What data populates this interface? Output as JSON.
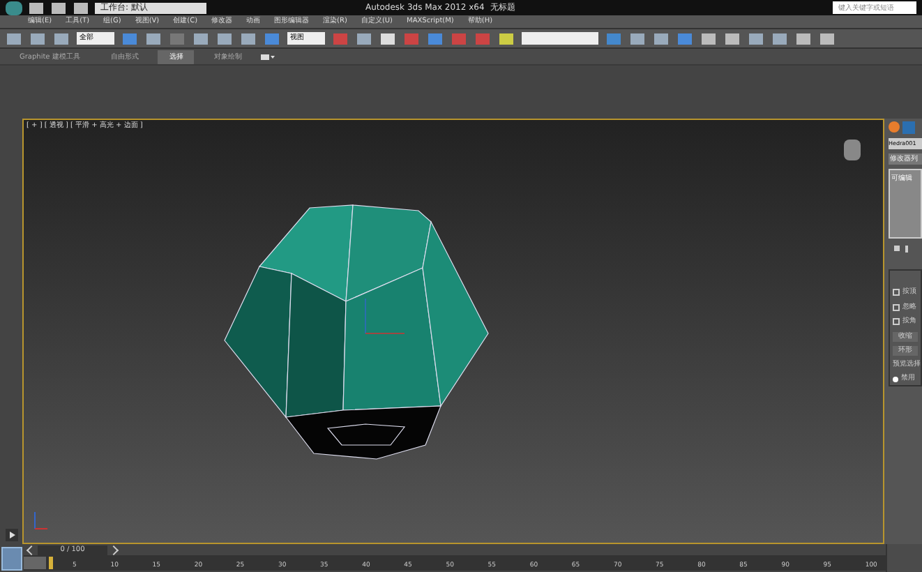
{
  "title_bar": {
    "workspace": "工作台: 默认",
    "title": "Autodesk 3ds Max 2012 x64",
    "document": "无标题",
    "search": {
      "placeholder": "键入关键字或短语"
    }
  },
  "menu": [
    "编辑(E)",
    "工具(T)",
    "组(G)",
    "视图(V)",
    "创建(C)",
    "修改器",
    "动画",
    "图形编辑器",
    "渲染(R)",
    "自定义(U)",
    "MAXScript(M)",
    "帮助(H)"
  ],
  "toolbar": {
    "selection_filter": "全部",
    "reference_coord": "视图"
  },
  "ribbon_tabs": [
    {
      "label": "Graphite 建模工具",
      "selected": false
    },
    {
      "label": "自由形式",
      "selected": false
    },
    {
      "label": "选择",
      "selected": true
    },
    {
      "label": "对象绘制",
      "selected": false
    }
  ],
  "viewport": {
    "label": "[ + ] [ 透视 ] [ 平滑 + 高光 + 边面 ]"
  },
  "command_panel": {
    "object_name": "Hedra001",
    "modifier_list": "修改器列",
    "stack_item": "可编辑",
    "options": [
      {
        "label": "按顶",
        "checked": false
      },
      {
        "label": "忽略",
        "checked": false
      },
      {
        "label": "按角",
        "checked": false
      }
    ],
    "buttons": [
      "收缩",
      "环形"
    ],
    "preview_group": "预览选择",
    "preview_option": {
      "label": "禁用",
      "selected": true
    }
  },
  "timeline": {
    "frame": "0 / 100",
    "ticks": [
      "5",
      "10",
      "15",
      "20",
      "25",
      "30",
      "35",
      "40",
      "45",
      "50",
      "55",
      "60",
      "65",
      "70",
      "75",
      "80",
      "85",
      "90",
      "95",
      "100"
    ]
  }
}
